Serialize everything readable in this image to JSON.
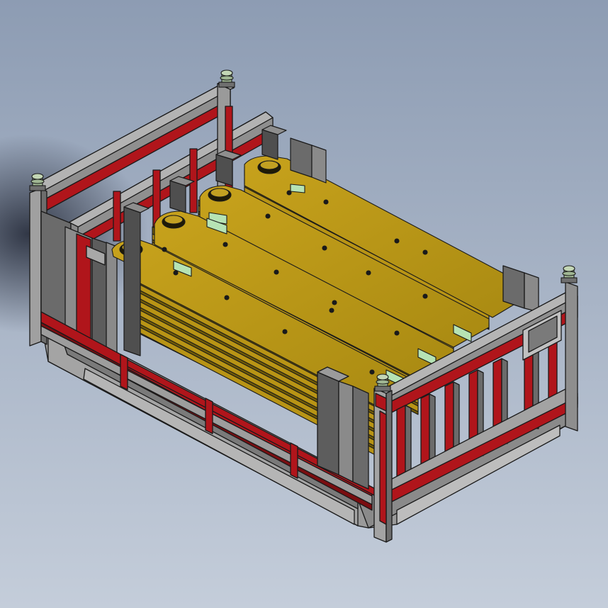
{
  "scene": {
    "subject": "cad-rack-with-stacked-plates",
    "stack_count": 4,
    "colors": {
      "background_top": "#8d9cb3",
      "background_bottom": "#c3ccd9",
      "frame_gray": "#8e8e8e",
      "frame_gray_dark": "#5e5e5e",
      "frame_red": "#b0151b",
      "frame_red_dark": "#7a0d10",
      "plate_gold": "#b89415",
      "plate_gold_dark": "#7d6408",
      "spacer_green": "#b6e3b4",
      "insulator": "#9fb592",
      "edge": "#1a1a1a"
    }
  }
}
